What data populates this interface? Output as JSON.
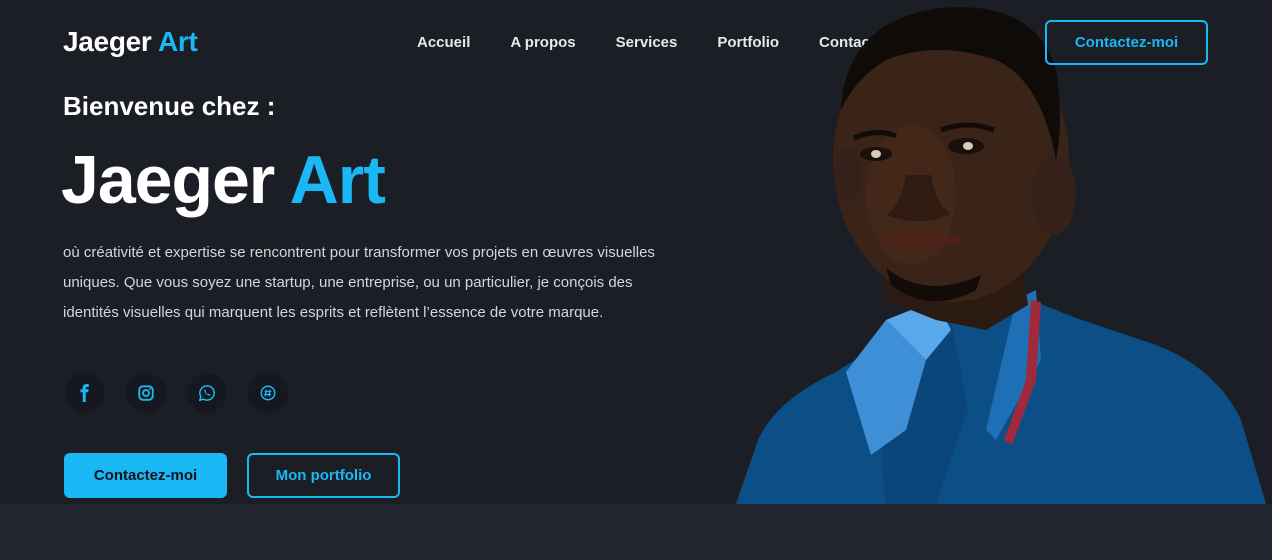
{
  "header": {
    "logo_main": "Jaeger",
    "logo_accent": "Art",
    "nav": [
      "Accueil",
      "A propos",
      "Services",
      "Portfolio",
      "Contact"
    ],
    "cta_label": "Contactez-moi"
  },
  "hero": {
    "welcome": "Bienvenue chez :",
    "title_main": "Jaeger",
    "title_accent": "Art",
    "intro": "où créativité et expertise se rencontrent pour transformer vos projets en œuvres visuelles uniques. Que vous soyez une startup, une entreprise, ou un particulier, je conçois des identités visuelles qui marquent les esprits et reflètent l’essence de votre marque.",
    "socials": [
      "facebook-icon",
      "instagram-icon",
      "whatsapp-icon",
      "threads-icon"
    ],
    "primary_button": "Contactez-moi",
    "secondary_button": "Mon portfolio"
  },
  "colors": {
    "accent": "#1ab8f5",
    "background": "#1b1e25",
    "band": "#212530"
  }
}
